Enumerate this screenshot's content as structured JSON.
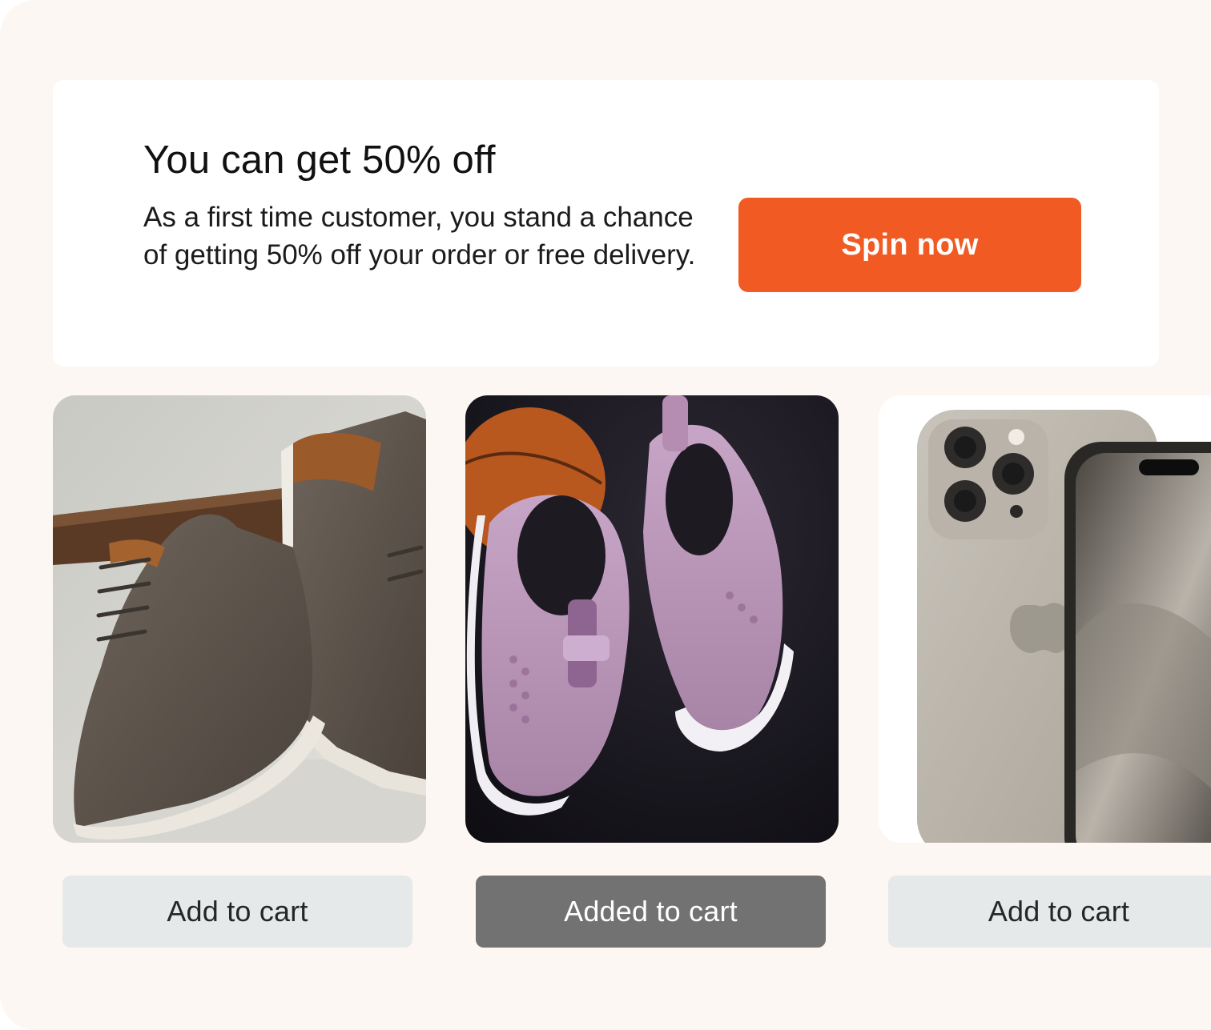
{
  "promo": {
    "title": "You can get 50% off",
    "text": "As a first time customer, you stand a chance of getting 50% off your order or free delivery.",
    "button_label": "Spin now",
    "accent_color": "#f15a22"
  },
  "products": [
    {
      "image": "brown-leather-sneakers-image",
      "button_label": "Add to cart",
      "state": "default"
    },
    {
      "image": "lilac-slip-on-sneakers-image",
      "button_label": "Added to cart",
      "state": "added"
    },
    {
      "image": "natural-titanium-smartphone-image",
      "button_label": "Add to cart",
      "state": "default"
    }
  ]
}
